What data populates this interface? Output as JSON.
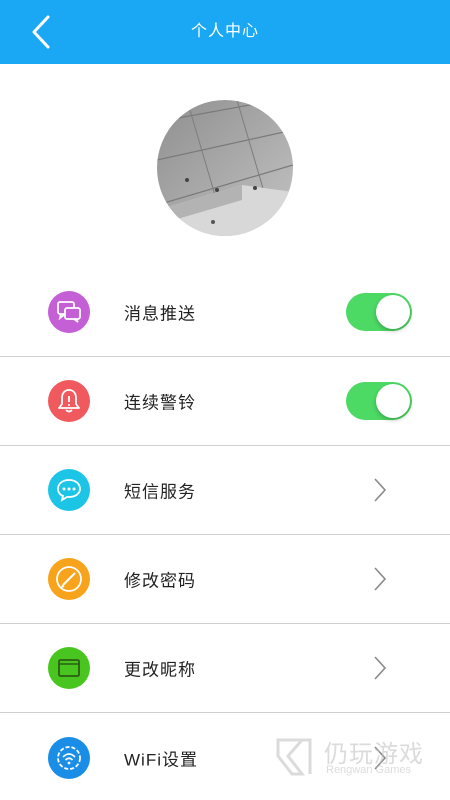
{
  "header": {
    "title": "个人中心",
    "back_icon": "chevron-left-icon",
    "color": "#1aa7f4"
  },
  "profile": {
    "avatar_icon": "avatar"
  },
  "items": [
    {
      "label": "消息推送",
      "icon": "chat-bubbles-icon",
      "icon_color": "#c45fd6",
      "control": "toggle",
      "on": true
    },
    {
      "label": "连续警铃",
      "icon": "bell-icon",
      "icon_color": "#f05a5f",
      "control": "toggle",
      "on": true
    },
    {
      "label": "短信服务",
      "icon": "sms-icon",
      "icon_color": "#1cc5e6",
      "control": "chevron"
    },
    {
      "label": "修改密码",
      "icon": "pencil-icon",
      "icon_color": "#f7a31b",
      "control": "chevron"
    },
    {
      "label": "更改昵称",
      "icon": "card-icon",
      "icon_color": "#49c51f",
      "control": "chevron"
    },
    {
      "label": "WiFi设置",
      "icon": "wifi-gear-icon",
      "icon_color": "#1a8ee6",
      "control": "chevron"
    }
  ],
  "toggle_color": "#4cd964",
  "watermark": {
    "text_cn": "仍玩游戏",
    "text_en": "Rengwan Games"
  }
}
